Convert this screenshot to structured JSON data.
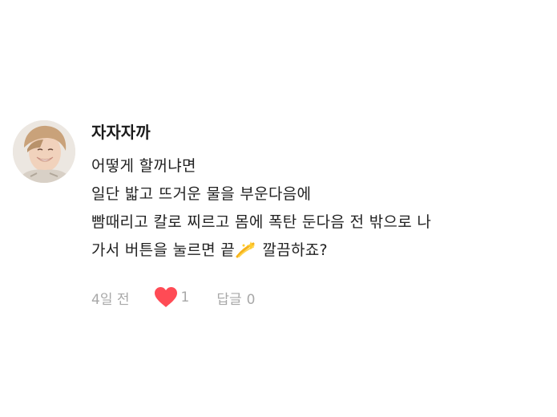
{
  "comment": {
    "username": "자자자까",
    "lines": [
      "어떻게 할꺼냐면",
      "일단 밟고 뜨거운 물을 부운다음에",
      "빰때리고 칼로 찌르고 몸에 폭탄 둔다음 전 밖으로 나"
    ],
    "last_line_before_emoji": "가서 버튼을 눌르면 끝",
    "emoji_icon": "dizzy-sparkle-icon",
    "last_line_after_emoji": " 깔끔하죠?",
    "time": "4일 전",
    "likes": "1",
    "reply_label": "답글",
    "reply_count": "0"
  },
  "colors": {
    "heart": "#ff4b55",
    "meta_text": "#a8a8a8",
    "body_text": "#222222"
  }
}
